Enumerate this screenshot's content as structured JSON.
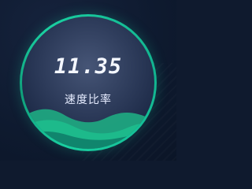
{
  "gauge": {
    "value": "11.35",
    "label": "速度比率"
  }
}
